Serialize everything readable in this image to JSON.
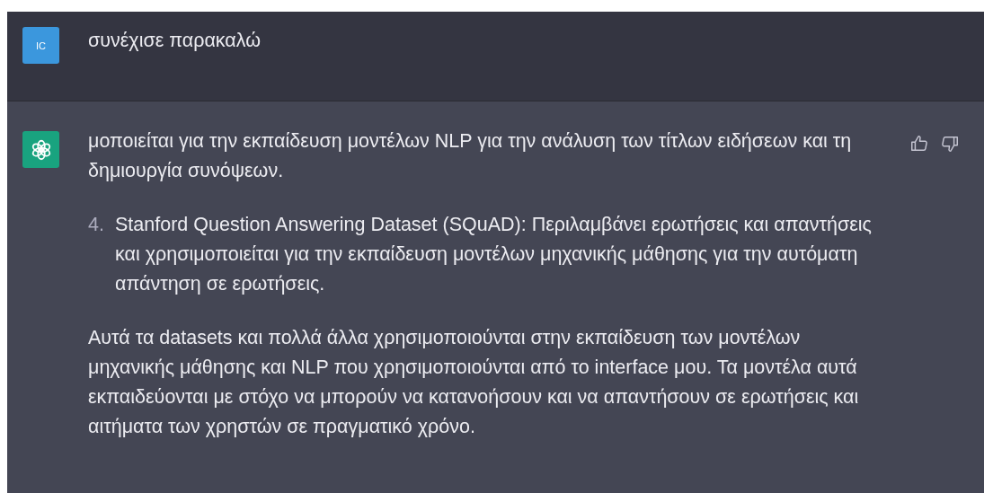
{
  "messages": [
    {
      "kind": "user",
      "avatar": "IC",
      "blocks": [
        {
          "kind": "paragraph",
          "text": "συνέχισε παρακαλώ"
        }
      ]
    },
    {
      "kind": "assistant",
      "blocks": [
        {
          "kind": "paragraph",
          "text": "μοποιείται για την εκπαίδευση μοντέλων NLP για την ανάλυση των τίτλων ειδήσεων και τη δημιουργία συνόψεων."
        },
        {
          "kind": "list_item",
          "number": "4.",
          "text": "Stanford Question Answering Dataset (SQuAD): Περιλαμβάνει ερωτήσεις και απαντήσεις και χρησιμοποιείται για την εκπαίδευση μοντέλων μηχανικής μάθησης για την αυτόματη απάντηση σε ερωτήσεις."
        },
        {
          "kind": "paragraph",
          "text": "Αυτά τα datasets και πολλά άλλα χρησιμοποιούνται στην εκπαίδευση των μοντέλων μηχανικής μάθησης και NLP που χρησιμοποιούνται από το interface μου. Τα μοντέλα αυτά εκπαιδεύονται με στόχο να μπορούν να κατανοήσουν και να απαντήσουν σε ερωτήσεις και αιτήματα των χρηστών σε πραγματικό χρόνο."
        }
      ]
    }
  ]
}
